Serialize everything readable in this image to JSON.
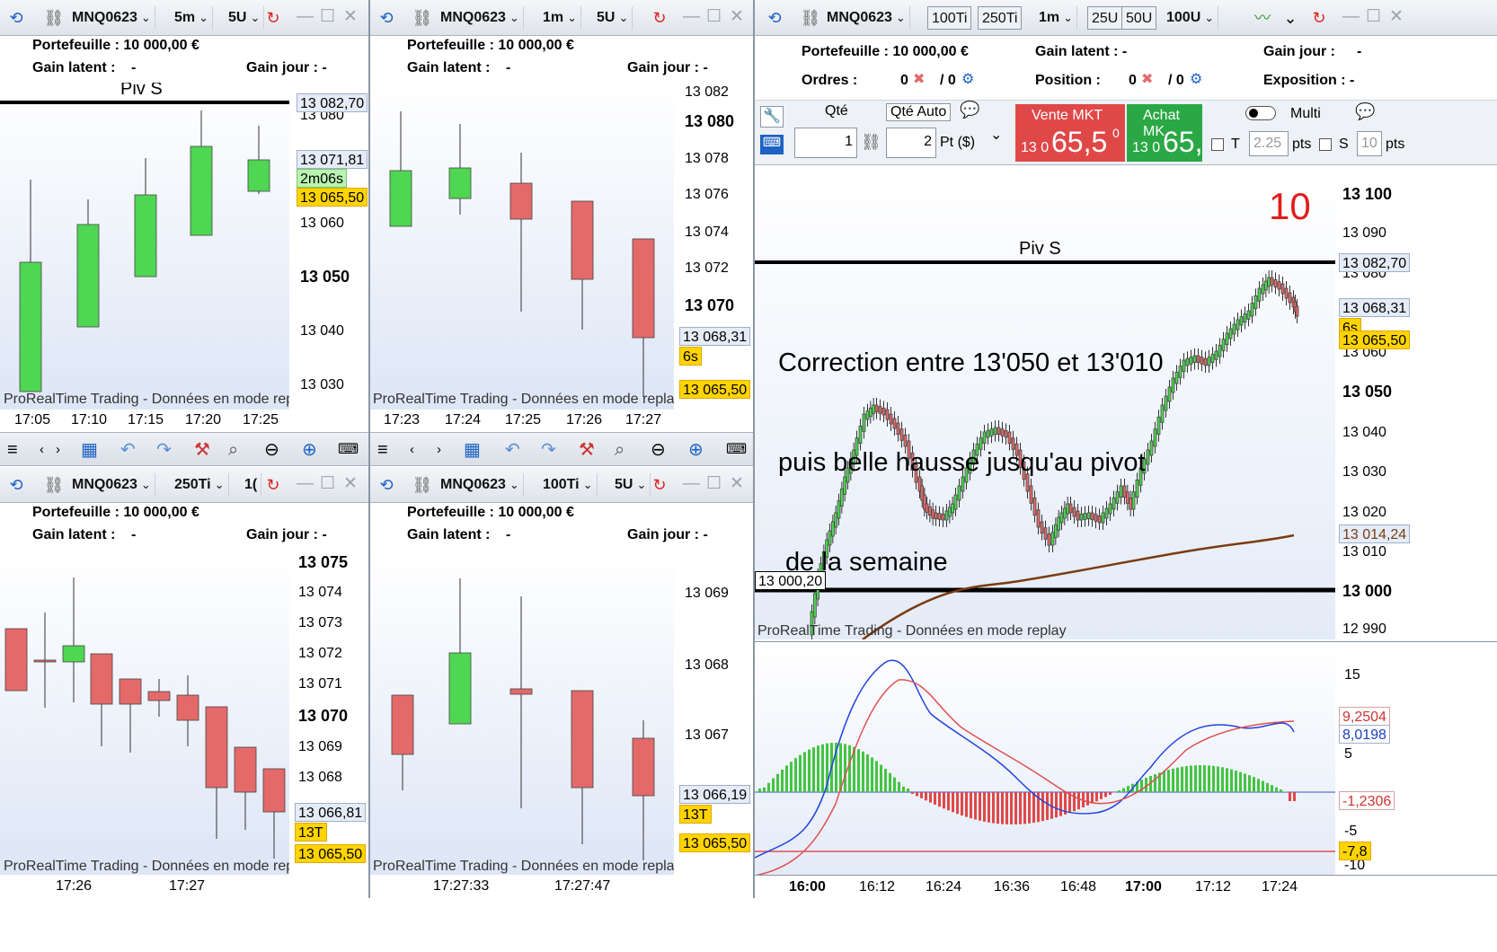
{
  "win1": {
    "symbol": "MNQ0623",
    "timeframe": "5m",
    "units": "5U",
    "portfolio": "Portefeuille : 10 000,00 €",
    "gain_latent": "Gain latent :",
    "gain_latent_val": "-",
    "gain_jour": "Gain jour : -",
    "pivot": "Piv S",
    "yticks": [
      "13 080",
      "13 060",
      "13 050",
      "13 040",
      "13 030"
    ],
    "pivot_label": "13 082,70",
    "hi_label": "13 071,81",
    "timer": "2m06s",
    "price": "13 065,50",
    "xticks": [
      "17:05",
      "17:10",
      "17:15",
      "17:20",
      "17:25"
    ],
    "watermark": "ProRealTime Trading - Données en mode replay",
    "candles": [
      {
        "o": 13051,
        "c": 13027,
        "h": 13066,
        "l": 13027,
        "up": true
      },
      {
        "o": 13040,
        "c": 13060,
        "h": 13062,
        "l": 13040,
        "up": true
      },
      {
        "o": 13054,
        "c": 13069,
        "h": 13075,
        "l": 13054,
        "up": true
      },
      {
        "o": 13059,
        "c": 13076,
        "h": 13080,
        "l": 13059,
        "up": true
      },
      {
        "o": 13070,
        "c": 13076,
        "h": 13079,
        "l": 13069,
        "up": true
      }
    ]
  },
  "win2": {
    "symbol": "MNQ0623",
    "timeframe": "1m",
    "units": "5U",
    "portfolio": "Portefeuille : 10 000,00 €",
    "gain_latent": "Gain latent :",
    "gain_latent_val": "-",
    "gain_jour": "Gain jour : -",
    "yticks": [
      "13 082",
      "13 080",
      "13 078",
      "13 076",
      "13 074",
      "13 072",
      "13 070"
    ],
    "hi_label": "13 068,31",
    "timer": "6s",
    "price": "13 065,50",
    "xticks": [
      "17:23",
      "17:24",
      "17:25",
      "17:26",
      "17:27"
    ],
    "watermark": "ProRealTime Trading - Données en mode replay"
  },
  "win3": {
    "symbol": "MNQ0623",
    "timeframe": "250Ti",
    "units": "1(",
    "portfolio": "Portefeuille : 10 000,00 €",
    "gain_latent": "Gain latent :",
    "gain_latent_val": "-",
    "gain_jour": "Gain jour : -",
    "yticks": [
      "13 075",
      "13 074",
      "13 073",
      "13 072",
      "13 071",
      "13 070",
      "13 069",
      "13 068"
    ],
    "hi_label": "13 066,81",
    "timer": "13T",
    "price": "13 065,50",
    "xticks": [
      "17:26",
      "17:27"
    ],
    "watermark": "ProRealTime Trading - Données en mode replay"
  },
  "win4": {
    "symbol": "MNQ0623",
    "timeframe": "100Ti",
    "units": "5U",
    "portfolio": "Portefeuille : 10 000,00 €",
    "gain_latent": "Gain latent :",
    "gain_latent_val": "-",
    "gain_jour": "Gain jour : -",
    "yticks": [
      "13 069",
      "13 068",
      "13 067"
    ],
    "hi_label": "13 066,19",
    "timer": "13T",
    "price": "13 065,50",
    "xticks": [
      "17:27:33",
      "17:27:47"
    ],
    "watermark": "ProRealTime Trading - Données en mode replay"
  },
  "main": {
    "symbol": "MNQ0623",
    "btns": [
      "100Ti",
      "250Ti"
    ],
    "timeframe": "1m",
    "unit_btns": [
      "25U",
      "50U"
    ],
    "units": "100U",
    "portfolio": "Portefeuille : 10 000,00 €",
    "gain_latent": "Gain latent : -",
    "gain_jour": "Gain jour :",
    "gain_jour_val": "-",
    "ordres": "Ordres :",
    "ordres_val": "0",
    "ordres_slash": "/ 0",
    "position": "Position :",
    "position_val": "0",
    "position_slash": "/ 0",
    "exposition": "Exposition : -",
    "qte_label": "Qté",
    "qte_auto": "Qté Auto",
    "qte_val": "1",
    "qte_auto_val": "2",
    "pt_label": "Pt ($)",
    "vente_label": "Vente MKT",
    "vente_price_small": "13 0",
    "vente_price_big": "65,5",
    "vente_sup": "0",
    "achat_label": "Achat MK",
    "achat_price_small": "13 0",
    "achat_price_big": "65,",
    "multi": "Multi",
    "t_label": "T",
    "t_val": "2.25",
    "t_unit": "pts",
    "s_label": "S",
    "s_val": "10",
    "s_unit": "pts",
    "count": "10",
    "pivot": "Piv S",
    "annotation": [
      "Correction entre 13'050 et 13'010",
      "puis belle hausse jusqu'au pivot",
      " de la semaine"
    ],
    "yticks": [
      "13 100",
      "13 090",
      "13 080",
      "13 060",
      "13 050",
      "13 040",
      "13 030",
      "13 020",
      "13 010",
      "13 000",
      "12 990"
    ],
    "lbl_pivot": "13 082,70",
    "lbl_hi": "13 068,31",
    "timer": "6s",
    "price": "13 065,50",
    "lbl_ma": "13 014,24",
    "lbl_left": "13 000,20",
    "watermark": "ProRealTime Trading - Données en mode replay",
    "ind_ticks": [
      "15",
      "5",
      "-5",
      "-10"
    ],
    "ind_lbl1": "9,2504",
    "ind_lbl2": "8,0198",
    "ind_lbl3": "-1,2306",
    "ind_lbl4": "-7,8",
    "xticks": [
      "16:00",
      "16:12",
      "16:24",
      "16:36",
      "16:48",
      "17:00",
      "17:12",
      "17:24"
    ]
  },
  "toolbar_icons": [
    "menu-icon",
    "scroll-left-icon",
    "scroll-right-icon",
    "calendar-icon",
    "undo-icon",
    "redo-icon",
    "tools-icon",
    "zoom-fit-icon",
    "zoom-out-icon",
    "zoom-in-icon",
    "keyboard-icon"
  ]
}
